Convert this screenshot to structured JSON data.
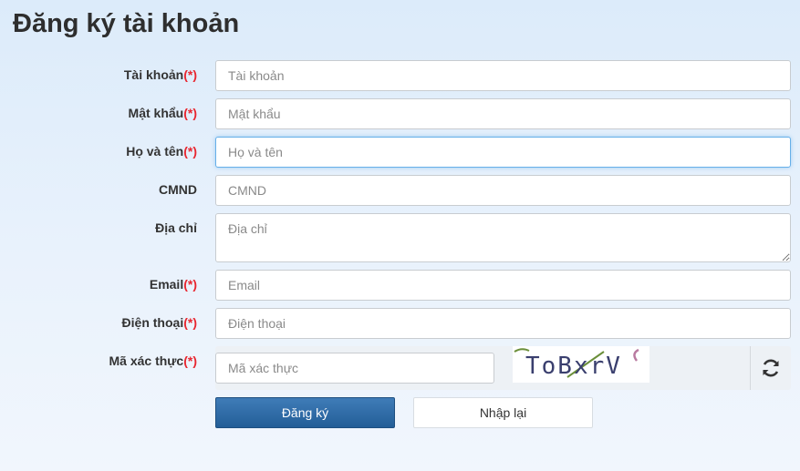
{
  "page": {
    "title": "Đăng ký tài khoản"
  },
  "required_marker": "(*)",
  "fields": {
    "account": {
      "label": "Tài khoản",
      "placeholder": "Tài khoản"
    },
    "password": {
      "label": "Mật khẩu",
      "placeholder": "Mật khẩu"
    },
    "fullname": {
      "label": "Họ và tên",
      "placeholder": "Họ và tên"
    },
    "idcard": {
      "label": "CMND",
      "placeholder": "CMND"
    },
    "address": {
      "label": "Địa chỉ",
      "placeholder": "Địa chỉ"
    },
    "email": {
      "label": "Email",
      "placeholder": "Email"
    },
    "phone": {
      "label": "Điện thoại",
      "placeholder": "Điện thoại"
    },
    "captcha": {
      "label": "Mã xác thực",
      "placeholder": "Mã xác thực",
      "image_text": "ToBxrV"
    }
  },
  "buttons": {
    "submit": "Đăng ký",
    "reset": "Nhập lại"
  },
  "colors": {
    "required": "#e8262f",
    "primary_button": "#2d6aa6",
    "focus_border": "#66afe9"
  },
  "icons": {
    "refresh": "refresh-icon"
  }
}
